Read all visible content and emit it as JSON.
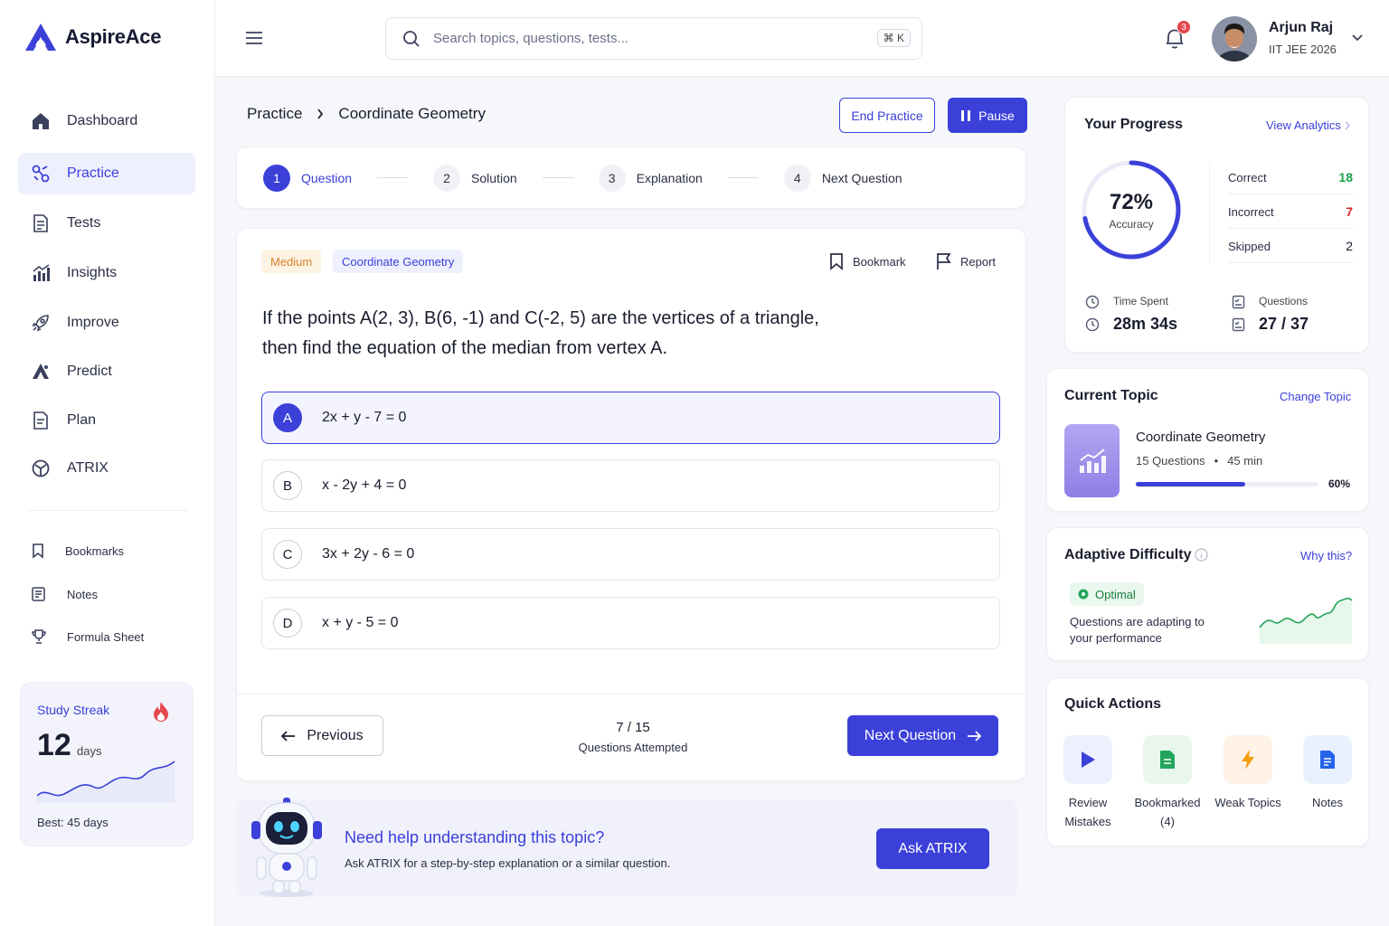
{
  "app": {
    "name": "AspireAce"
  },
  "sidebar": {
    "items": [
      {
        "label": "Dashboard"
      },
      {
        "label": "Practice"
      },
      {
        "label": "Tests"
      },
      {
        "label": "Insights"
      },
      {
        "label": "Improve"
      },
      {
        "label": "Predict"
      },
      {
        "label": "Plan"
      },
      {
        "label": "ATRIX"
      }
    ],
    "secondary": [
      {
        "label": "Bookmarks"
      },
      {
        "label": "Notes"
      },
      {
        "label": "Formula Sheet"
      }
    ],
    "streak": {
      "title": "Study Streak",
      "value": "12",
      "unit": "days",
      "best": "Best: 45 days"
    }
  },
  "topbar": {
    "search_placeholder": "Search topics, questions, tests...",
    "shortcut": "⌘ K",
    "notification_count": "3",
    "user": {
      "name": "Arjun Raj",
      "subtitle": "IIT JEE 2026"
    }
  },
  "breadcrumb": {
    "root": "Practice",
    "current": "Coordinate Geometry"
  },
  "actions": {
    "end_label": "End Practice",
    "pause_label": "Pause"
  },
  "steps": [
    {
      "num": "1",
      "label": "Question"
    },
    {
      "num": "2",
      "label": "Solution"
    },
    {
      "num": "3",
      "label": "Explanation"
    },
    {
      "num": "4",
      "label": "Next Question"
    }
  ],
  "question": {
    "difficulty": "Medium",
    "topic": "Coordinate Geometry",
    "bookmark_label": "Bookmark",
    "report_label": "Report",
    "text_line1": "If the points A(2, 3), B(6, -1) and C(-2, 5) are the vertices of a triangle,",
    "text_line2": "then find the equation of the median from vertex A.",
    "options": [
      {
        "letter": "A",
        "text": "2x + y - 7 = 0"
      },
      {
        "letter": "B",
        "text": "x - 2y + 4 = 0"
      },
      {
        "letter": "C",
        "text": "3x + 2y - 6 = 0"
      },
      {
        "letter": "D",
        "text": "x + y - 5 = 0"
      }
    ],
    "selected": "A"
  },
  "pager": {
    "previous_label": "Previous",
    "count": "7 / 15",
    "count_label": "Questions Attempted",
    "next_label": "Next Question"
  },
  "help": {
    "title": "Need help understanding this topic?",
    "subtitle": "Ask ATRIX for a step-by-step explanation or a similar question.",
    "button": "Ask ATRIX"
  },
  "progress": {
    "title": "Your Progress",
    "link": "View Analytics",
    "accuracy_value": "72%",
    "accuracy_fraction": 0.72,
    "accuracy_label": "Accuracy",
    "stats": [
      {
        "label": "Correct",
        "value": "18",
        "color": "#16a34a"
      },
      {
        "label": "Incorrect",
        "value": "7",
        "color": "#dc2626"
      },
      {
        "label": "Skipped",
        "value": "2",
        "color": "#1a1d2e"
      }
    ],
    "time_label": "Time Spent",
    "time_value": "28m 34s",
    "questions_label": "Questions",
    "questions_value": "27 / 37"
  },
  "current_topic": {
    "title": "Current Topic",
    "link": "Change Topic",
    "name": "Coordinate Geometry",
    "questions": "15 Questions",
    "duration": "45 min",
    "percent_label": "60%",
    "percent": 0.6
  },
  "adaptive": {
    "title": "Adaptive Difficulty",
    "link": "Why this?",
    "status": "Optimal",
    "desc_line1": "Questions are adapting to",
    "desc_line2": "your performance"
  },
  "quick_actions": {
    "title": "Quick Actions",
    "items": [
      {
        "line1": "Review",
        "line2": "Mistakes"
      },
      {
        "line1": "Bookmarked",
        "line2": "(4)"
      },
      {
        "line1": "Weak Topics",
        "line2": ""
      },
      {
        "line1": "Notes",
        "line2": ""
      }
    ]
  },
  "colors": {
    "accent": "#3b40d9",
    "correct": "#16a34a",
    "incorrect": "#dc2626",
    "streak_fire": "#e5484d"
  }
}
